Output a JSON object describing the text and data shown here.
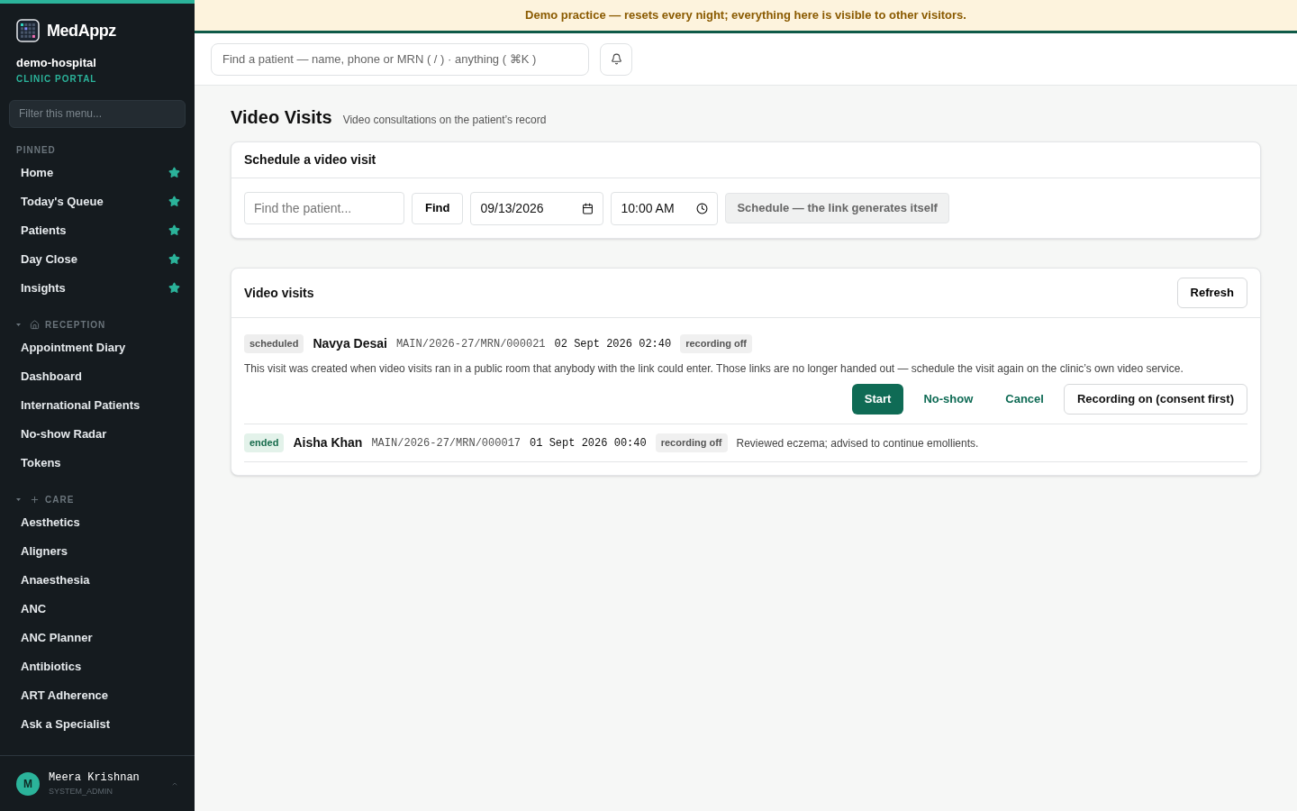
{
  "brand": {
    "name": "MedAppz",
    "tenant": "demo-hospital",
    "portal": "CLINIC PORTAL"
  },
  "sidebar": {
    "filter_placeholder": "Filter this menu...",
    "sections": [
      {
        "title": "PINNED",
        "kind": "pinned",
        "items": [
          {
            "label": "Home",
            "pinned": true
          },
          {
            "label": "Today's Queue",
            "pinned": true
          },
          {
            "label": "Patients",
            "pinned": true
          },
          {
            "label": "Day Close",
            "pinned": true
          },
          {
            "label": "Insights",
            "pinned": true
          }
        ]
      },
      {
        "title": "RECEPTION",
        "kind": "reception",
        "expanded": true,
        "items": [
          {
            "label": "Appointment Diary",
            "pinned": false
          },
          {
            "label": "Dashboard",
            "pinned": false
          },
          {
            "label": "International Patients",
            "pinned": false
          },
          {
            "label": "No-show Radar",
            "pinned": false
          },
          {
            "label": "Tokens",
            "pinned": false
          }
        ]
      },
      {
        "title": "CARE",
        "kind": "care",
        "expanded": true,
        "items": [
          {
            "label": "Aesthetics",
            "pinned": false
          },
          {
            "label": "Aligners",
            "pinned": false
          },
          {
            "label": "Anaesthesia",
            "pinned": false
          },
          {
            "label": "ANC",
            "pinned": false
          },
          {
            "label": "ANC Planner",
            "pinned": false
          },
          {
            "label": "Antibiotics",
            "pinned": false
          },
          {
            "label": "ART Adherence",
            "pinned": false
          },
          {
            "label": "Ask a Specialist",
            "pinned": false
          }
        ]
      }
    ],
    "user": {
      "initial": "M",
      "name": "Meera Krishnan",
      "role": "SYSTEM_ADMIN"
    }
  },
  "banner": "Demo practice — resets every night; everything here is visible to other visitors.",
  "topbar": {
    "search_placeholder": "Find a patient — name, phone or MRN ( / ) · anything ( ⌘K )"
  },
  "page": {
    "title": "Video Visits",
    "subtitle": "Video consultations on the patient’s record"
  },
  "schedule": {
    "title": "Schedule a video visit",
    "patient_placeholder": "Find the patient...",
    "find": "Find",
    "date": "09/13/2026",
    "time": "10:00 AM",
    "submit": "Schedule — the link generates itself"
  },
  "visits": {
    "title": "Video visits",
    "refresh": "Refresh",
    "rows": [
      {
        "status": "scheduled",
        "kind": "scheduled",
        "patient": "Navya Desai",
        "mrn": "MAIN/2026-27/MRN/000021",
        "when": "02 Sept 2026 02:40",
        "recording": "recording off",
        "note": "This visit was created when video visits ran in a public room that anybody with the link could enter. Those links are no longer handed out — schedule the visit again on the clinic’s own video service.",
        "actions": [
          "Start",
          "No-show",
          "Cancel",
          "Recording on (consent first)"
        ]
      },
      {
        "status": "ended",
        "kind": "ended",
        "patient": "Aisha Khan",
        "mrn": "MAIN/2026-27/MRN/000017",
        "when": "01 Sept 2026 00:40",
        "recording": "recording off",
        "summary": "Reviewed eczema; advised to continue emollients."
      }
    ]
  }
}
